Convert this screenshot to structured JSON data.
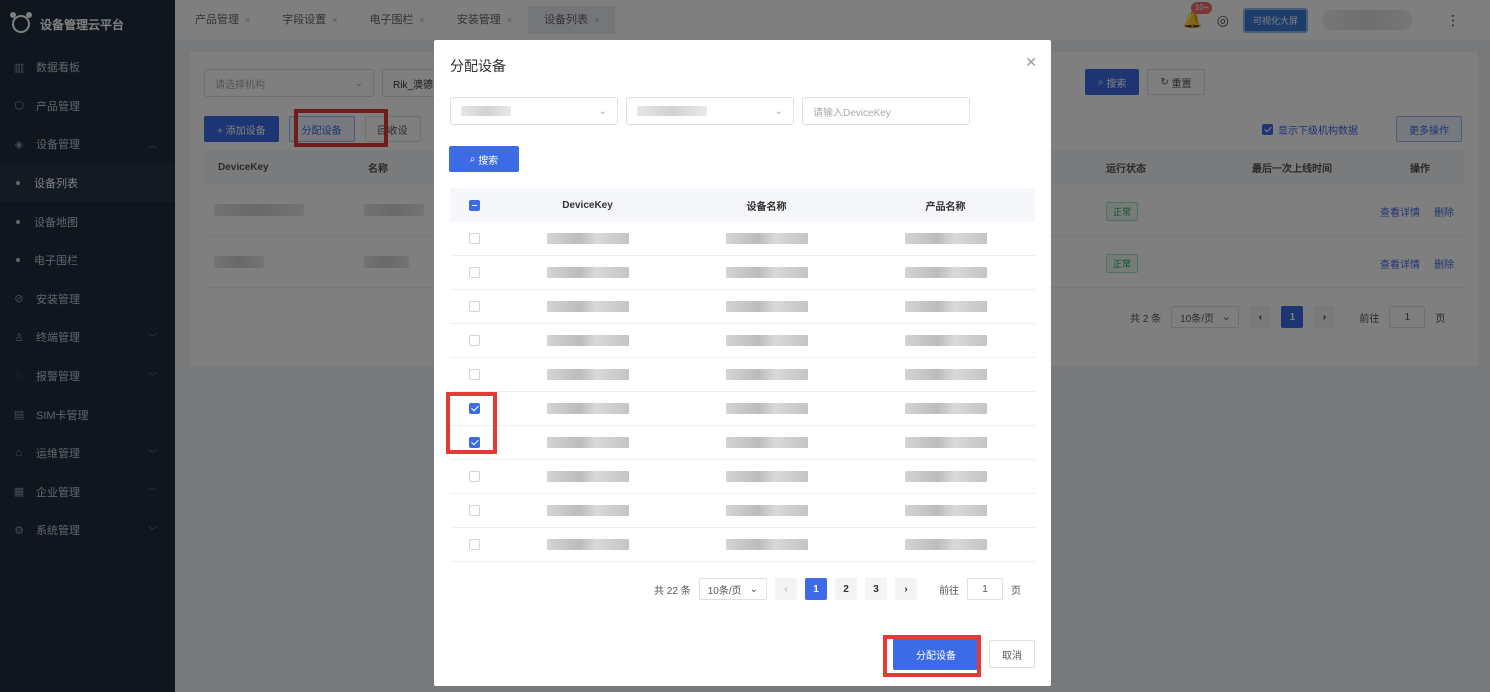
{
  "app": {
    "title": "设备管理云平台"
  },
  "sidebar": {
    "items": [
      {
        "label": "数据看板",
        "icon": "chart-icon"
      },
      {
        "label": "产品管理",
        "icon": "cube-icon"
      },
      {
        "label": "设备管理",
        "icon": "device-icon",
        "expanded": true
      },
      {
        "label": "设备列表",
        "sub": true,
        "active": true
      },
      {
        "label": "设备地图",
        "sub": true
      },
      {
        "label": "电子围栏",
        "sub": true
      },
      {
        "label": "安装管理",
        "icon": "install-icon"
      },
      {
        "label": "终端管理",
        "icon": "user-icon",
        "arrow": true
      },
      {
        "label": "报警管理",
        "icon": "alarm-icon",
        "arrow": true
      },
      {
        "label": "SIM卡管理",
        "icon": "sim-icon"
      },
      {
        "label": "运维管理",
        "icon": "ops-icon",
        "arrow": true
      },
      {
        "label": "企业管理",
        "icon": "company-icon",
        "arrow": true
      },
      {
        "label": "系统管理",
        "icon": "settings-icon",
        "arrow": true
      }
    ]
  },
  "topbar": {
    "tabs": [
      "产品管理",
      "字段设置",
      "电子围栏",
      "安装管理",
      "设备列表"
    ],
    "active_tab": 4,
    "badge": "10+",
    "bigscreen_label": "可视化大屏"
  },
  "main": {
    "org_placeholder": "请选择机构",
    "org_value": "Rik_澳德",
    "search_btn": "搜索",
    "reset_btn": "重置",
    "add_btn": "+ 添加设备",
    "assign_btn": "分配设备",
    "recycle_btn": "回收设",
    "show_sub_label": "显示下级机构数据",
    "more_btn": "更多操作",
    "columns": [
      "DeviceKey",
      "名称",
      "运行状态",
      "最后一次上线时间",
      "操作"
    ],
    "rows": [
      {
        "status": "正常",
        "view": "查看详情",
        "delete": "删除"
      },
      {
        "status": "正常",
        "view": "查看详情",
        "delete": "删除"
      }
    ],
    "pager": {
      "total": "共 2 条",
      "size": "10条/页",
      "page": "1",
      "goto": "前往",
      "goto_val": "1",
      "page_unit": "页"
    }
  },
  "dialog": {
    "title": "分配设备",
    "key_placeholder": "请输入DeviceKey",
    "search_btn": "搜索",
    "columns": [
      "DeviceKey",
      "设备名称",
      "产品名称"
    ],
    "rows": [
      {
        "checked": false
      },
      {
        "checked": false
      },
      {
        "checked": false
      },
      {
        "checked": false
      },
      {
        "checked": false
      },
      {
        "checked": true
      },
      {
        "checked": true
      },
      {
        "checked": false
      },
      {
        "checked": false
      },
      {
        "checked": false
      }
    ],
    "pager": {
      "total": "共 22 条",
      "size": "10条/页",
      "pages": [
        "1",
        "2",
        "3"
      ],
      "active": "1",
      "goto": "前往",
      "goto_val": "1",
      "page_unit": "页"
    },
    "confirm_btn": "分配设备",
    "cancel_btn": "取消"
  },
  "colors": {
    "primary": "#3d6be6",
    "highlight": "#e53935",
    "sidebar": "#1f2d3d",
    "status_ok": "#19a05a"
  }
}
